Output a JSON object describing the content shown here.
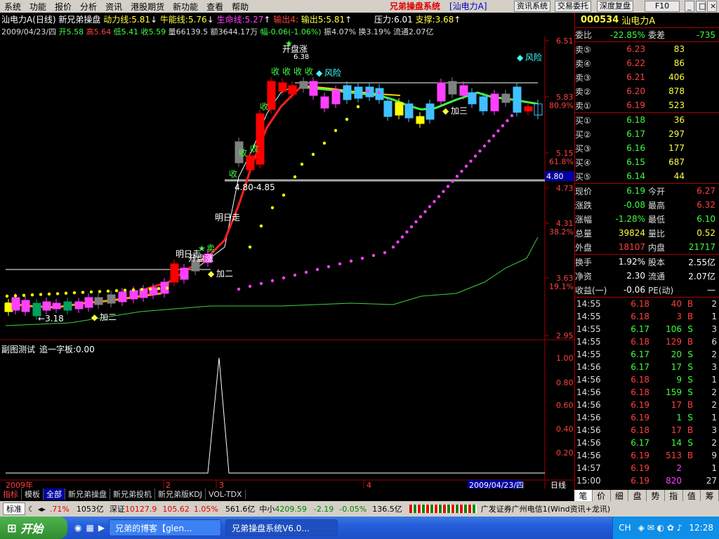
{
  "menu": {
    "items": [
      "系统",
      "功能",
      "报价",
      "分析",
      "资讯",
      "港股期货",
      "新功能",
      "查看",
      "帮助"
    ],
    "title": "兄弟操盘系统",
    "subtitle": "[汕电力A]",
    "buttons": [
      "资讯系统",
      "交易委托",
      "深度复盘",
      "F10"
    ]
  },
  "chart": {
    "header": {
      "name": "汕电力A",
      "period": "(日线)",
      "formula": "新兄弟操盘",
      "l1": "动力线:5.81",
      "l2": "牛能线:5.76",
      "l3": "生命线:5.27",
      "l4": "输出4:",
      "l5": "输出5:5.81",
      "pressure": "压力:6.01",
      "support": "支撑:3.68"
    },
    "info": {
      "date": "2009/04/23/四",
      "open": "开5.58",
      "high": "高5.64",
      "low": "低5.41",
      "close": "收5.59",
      "vol": "量66139.5",
      "amount": "额3644.17万",
      "change": "幅-0.06(-1.06%)",
      "amp": "振4.07%",
      "turnover": "换3.19%",
      "float": "流通2.07亿"
    },
    "yaxis": [
      "6.51",
      "5.83",
      "5.15",
      "4.73",
      "4.31",
      "3.63",
      "2.95"
    ],
    "pct": [
      "80.9%",
      "61.8%",
      "38.2%",
      "19.1%"
    ],
    "hline": "4.80",
    "annot": {
      "top": "开盘涨",
      "topv": "6.38",
      "risk1": "风险",
      "risk2": "风险",
      "shou": "收",
      "buy": "卖",
      "jia": "加三",
      "jia2": "加二",
      "mid": "明日走",
      "open2": "开盘涨",
      "line1": "4.80-4.85",
      "low": "3.18",
      "jia3": "加二",
      "mingri2": "明日走"
    },
    "sub": {
      "title": "副图测试",
      "name": "追一字板:0.00",
      "yaxis": [
        "1.00",
        "0.80",
        "0.60",
        "0.40",
        "0.20"
      ]
    },
    "xaxis": {
      "y": "2009年",
      "m2": "2",
      "m3": "3",
      "m4": "4",
      "date": "2009/04/23/四",
      "period": "日线"
    }
  },
  "quote": {
    "code": "000534",
    "name": "汕电力A",
    "wei": {
      "label": "委比",
      "val": "-22.85%",
      "label2": "委差",
      "val2": "-735"
    },
    "sell": [
      {
        "l": "卖⑤",
        "p": "6.23",
        "v": "83"
      },
      {
        "l": "卖④",
        "p": "6.22",
        "v": "86"
      },
      {
        "l": "卖③",
        "p": "6.21",
        "v": "406"
      },
      {
        "l": "卖②",
        "p": "6.20",
        "v": "878"
      },
      {
        "l": "卖①",
        "p": "6.19",
        "v": "523"
      }
    ],
    "buy": [
      {
        "l": "买①",
        "p": "6.18",
        "v": "36"
      },
      {
        "l": "买②",
        "p": "6.17",
        "v": "297"
      },
      {
        "l": "买③",
        "p": "6.16",
        "v": "177"
      },
      {
        "l": "买④",
        "p": "6.15",
        "v": "687"
      },
      {
        "l": "买⑤",
        "p": "6.14",
        "v": "44"
      }
    ],
    "stats": [
      {
        "a": "现价",
        "av": "6.19",
        "b": "今开",
        "bv": "6.27"
      },
      {
        "a": "涨跌",
        "av": "-0.08",
        "b": "最高",
        "bv": "6.32"
      },
      {
        "a": "涨幅",
        "av": "-1.28%",
        "b": "最低",
        "bv": "6.10"
      },
      {
        "a": "总量",
        "av": "39824",
        "b": "量比",
        "bv": "0.52"
      },
      {
        "a": "外盘",
        "av": "18107",
        "b": "内盘",
        "bv": "21717"
      }
    ],
    "stats2": [
      {
        "a": "换手",
        "av": "1.92%",
        "b": "股本",
        "bv": "2.55亿"
      },
      {
        "a": "净资",
        "av": "2.30",
        "b": "流通",
        "bv": "2.07亿"
      },
      {
        "a": "收益(一)",
        "av": "-0.06",
        "b": "PE(动)",
        "bv": "—"
      }
    ],
    "ticks": [
      [
        "14:55",
        "6.18",
        "40",
        "B",
        "2"
      ],
      [
        "14:55",
        "6.18",
        "3",
        "B",
        "1"
      ],
      [
        "14:55",
        "6.17",
        "106",
        "S",
        "3"
      ],
      [
        "14:55",
        "6.18",
        "129",
        "B",
        "6"
      ],
      [
        "14:55",
        "6.17",
        "20",
        "S",
        "2"
      ],
      [
        "14:56",
        "6.17",
        "17",
        "S",
        "3"
      ],
      [
        "14:56",
        "6.18",
        "9",
        "S",
        "1"
      ],
      [
        "14:56",
        "6.18",
        "159",
        "S",
        "2"
      ],
      [
        "14:56",
        "6.19",
        "17",
        "B",
        "2"
      ],
      [
        "14:56",
        "6.19",
        "1",
        "S",
        "1"
      ],
      [
        "14:56",
        "6.18",
        "17",
        "B",
        "3"
      ],
      [
        "14:56",
        "6.17",
        "14",
        "S",
        "2"
      ],
      [
        "14:56",
        "6.19",
        "513",
        "B",
        "9"
      ],
      [
        "14:57",
        "6.19",
        "2",
        "",
        "1"
      ],
      [
        "15:00",
        "6.19",
        "820",
        "",
        "27"
      ]
    ],
    "tabs": [
      "笔",
      "价",
      "细",
      "盘",
      "势",
      "指",
      "值",
      "筹"
    ]
  },
  "bottomtabs": [
    "指标",
    "模板",
    "全部",
    "新兄弟操盘",
    "新兄弟投机",
    "新兄弟版KDJ",
    "VOL-TDX"
  ],
  "status": {
    "std": "标准",
    "p1": ".71%",
    "v1": "1053亿",
    "sz": "深证",
    "szv": "10127.9",
    "szc": "105.62",
    "szp": "1.05%",
    "szm": "561.6亿",
    "zx": "中小",
    "zxv": "4209.59",
    "zxc": "-2.19",
    "zxp": "-0.05%",
    "zxm": "136.5亿",
    "broker": "广发证券广州电信1(Wind资讯+龙讯)"
  },
  "taskbar": {
    "start": "开始",
    "t1": "兄弟的博客【glen...",
    "t2": "兄弟操盘系统V6.0...",
    "tray": "CH",
    "time": "12:28"
  }
}
